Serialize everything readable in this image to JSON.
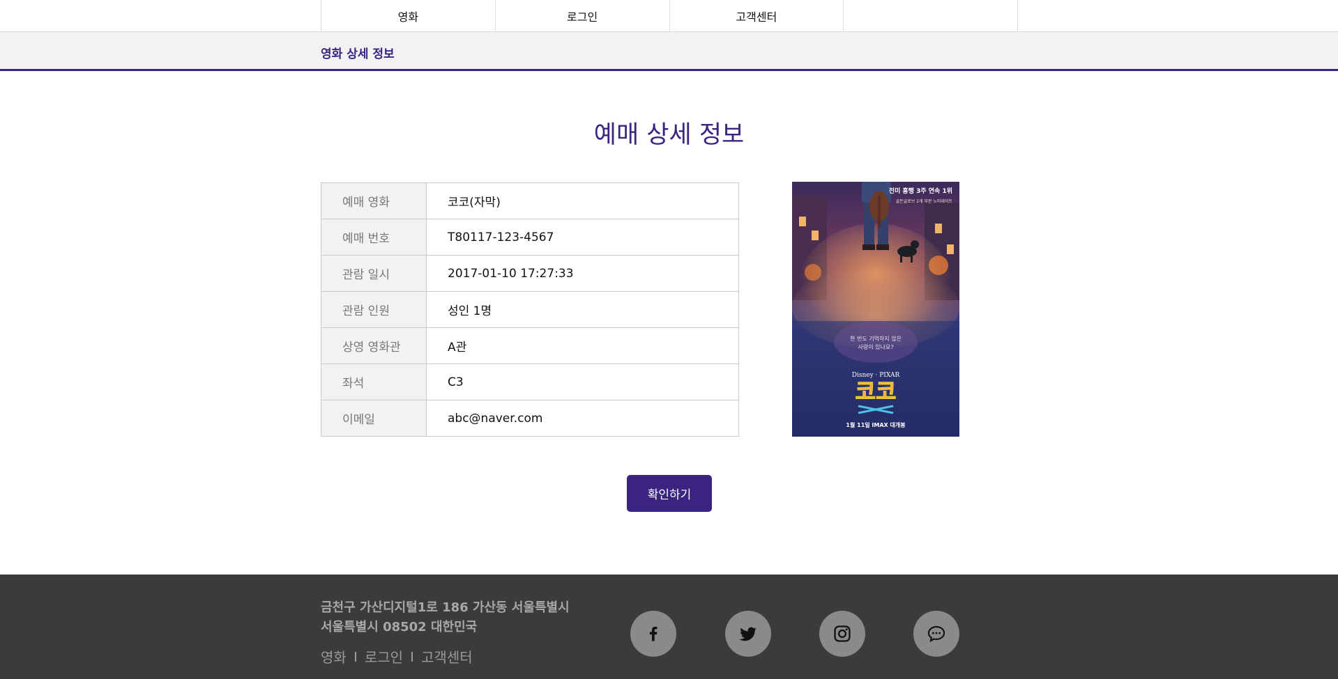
{
  "nav": {
    "items": [
      {
        "label": "영화"
      },
      {
        "label": "로그인"
      },
      {
        "label": "고객센터"
      }
    ]
  },
  "subbar": {
    "title": "영화 상세 정보"
  },
  "page": {
    "heading": "예매 상세 정보"
  },
  "details": [
    {
      "label": "예매 영화",
      "value": "코코(자막)"
    },
    {
      "label": "예매 번호",
      "value": "T80117-123-4567"
    },
    {
      "label": "관람 일시",
      "value": "2017-01-10 17:27:33"
    },
    {
      "label": "관람 인원",
      "value": "성인 1명"
    },
    {
      "label": "상영 영화관",
      "value": "A관"
    },
    {
      "label": "좌석",
      "value": "C3"
    },
    {
      "label": "이메일",
      "value": "abc@naver.com"
    }
  ],
  "poster": {
    "top_text_1": "전미 흥행 3주 연속 1위",
    "top_text_2": "골든글로브 2개 부문 노미네이트",
    "mid_text_1": "한 번도 기억하지 않은",
    "mid_text_2": "사랑이 있나요?",
    "brand": "Disney · PIXAR",
    "title": "코코",
    "release": "1월 11일 IMAX 대개봉"
  },
  "button": {
    "confirm": "확인하기"
  },
  "footer": {
    "address_line1": "금천구 가산디지털1로 186 가산동 서울특별시",
    "address_line2": "서울특별시 08502 대한민국",
    "links": [
      {
        "label": "영화"
      },
      {
        "label": "로그인"
      },
      {
        "label": "고객센터"
      }
    ],
    "social": [
      {
        "icon": "facebook-icon"
      },
      {
        "icon": "twitter-icon"
      },
      {
        "icon": "instagram-icon"
      },
      {
        "icon": "chat-icon"
      }
    ]
  },
  "colors": {
    "accent": "#3a2480",
    "footer_bg": "#3b3b3b",
    "label_bg": "#f2f2f2"
  }
}
